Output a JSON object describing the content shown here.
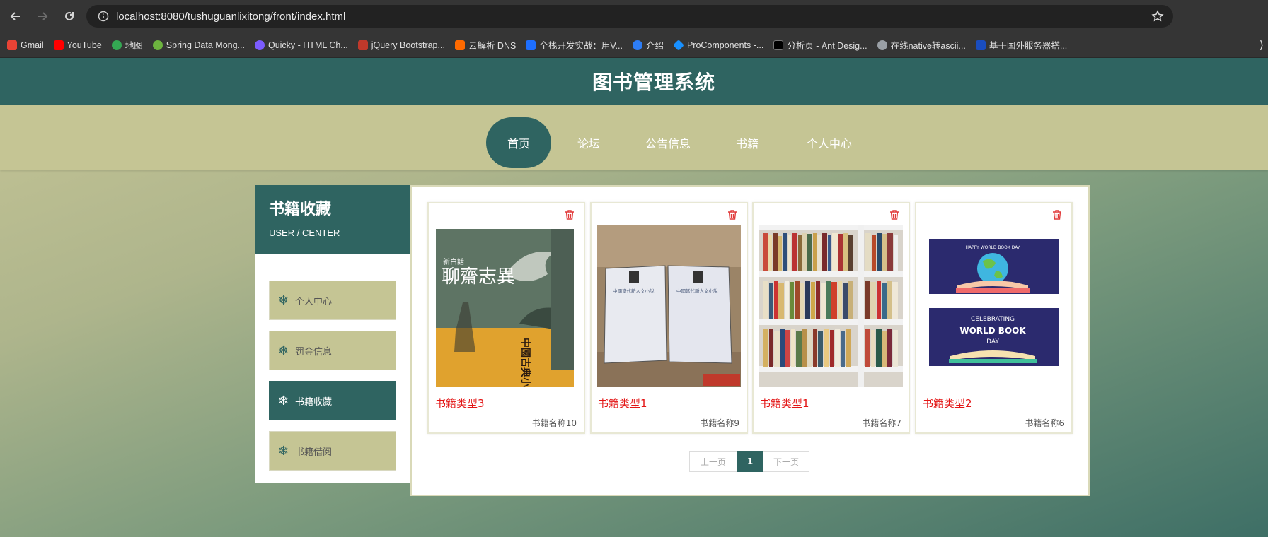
{
  "browser": {
    "url": "localhost:8080/tushuguanlixitong/front/index.html",
    "bookmarks": [
      {
        "label": "Gmail",
        "color": "#ea4335"
      },
      {
        "label": "YouTube",
        "color": "#ff0000"
      },
      {
        "label": "地图",
        "color": "#34a853"
      },
      {
        "label": "Spring Data Mong...",
        "color": "#6db33f"
      },
      {
        "label": "Quicky - HTML Ch...",
        "color": "#7b5cff"
      },
      {
        "label": "jQuery Bootstrap...",
        "color": "#c0392b"
      },
      {
        "label": "云解析 DNS",
        "color": "#ff6a00"
      },
      {
        "label": "全栈开发实战：用V...",
        "color": "#1e6fff"
      },
      {
        "label": "介绍",
        "color": "#2d7df6"
      },
      {
        "label": "ProComponents -...",
        "color": "#1890ff"
      },
      {
        "label": "分析页 - Ant Desig...",
        "color": "#000000"
      },
      {
        "label": "在线native转ascii...",
        "color": "#9aa0a6"
      },
      {
        "label": "基于国外服务器搭...",
        "color": "#1a4dbf"
      }
    ],
    "more": "⟩"
  },
  "site": {
    "title": "图书管理系统"
  },
  "nav": {
    "items": [
      "首页",
      "论坛",
      "公告信息",
      "书籍",
      "个人中心"
    ],
    "active_index": 0
  },
  "sidebar": {
    "title": "书籍收藏",
    "subtitle": "USER / CENTER",
    "items": [
      "个人中心",
      "罚金信息",
      "书籍收藏",
      "书籍借阅"
    ],
    "active_index": 2
  },
  "cards": [
    {
      "type": "书籍类型3",
      "name": "书籍名称10",
      "cover": "book-cover-liaozhai"
    },
    {
      "type": "书籍类型1",
      "name": "书籍名称9",
      "cover": "two-books-box"
    },
    {
      "type": "书籍类型1",
      "name": "书籍名称7",
      "cover": "bookshelf"
    },
    {
      "type": "书籍类型2",
      "name": "书籍名称6",
      "cover": "world-book-day"
    }
  ],
  "cover_text": {
    "liaozhai_small": "新白話",
    "liaozhai_title": "聊齋志異",
    "liaozhai_side": "中國古典小說的翹楚之作",
    "book_label": "中國當代新人文小說",
    "wbd_top": "HAPPY WORLD BOOK DAY",
    "wbd_celebrating": "CELEBRATING",
    "wbd_main": "WORLD BOOK",
    "wbd_day": "DAY"
  },
  "pagination": {
    "prev": "上一页",
    "current": "1",
    "next": "下一页"
  }
}
